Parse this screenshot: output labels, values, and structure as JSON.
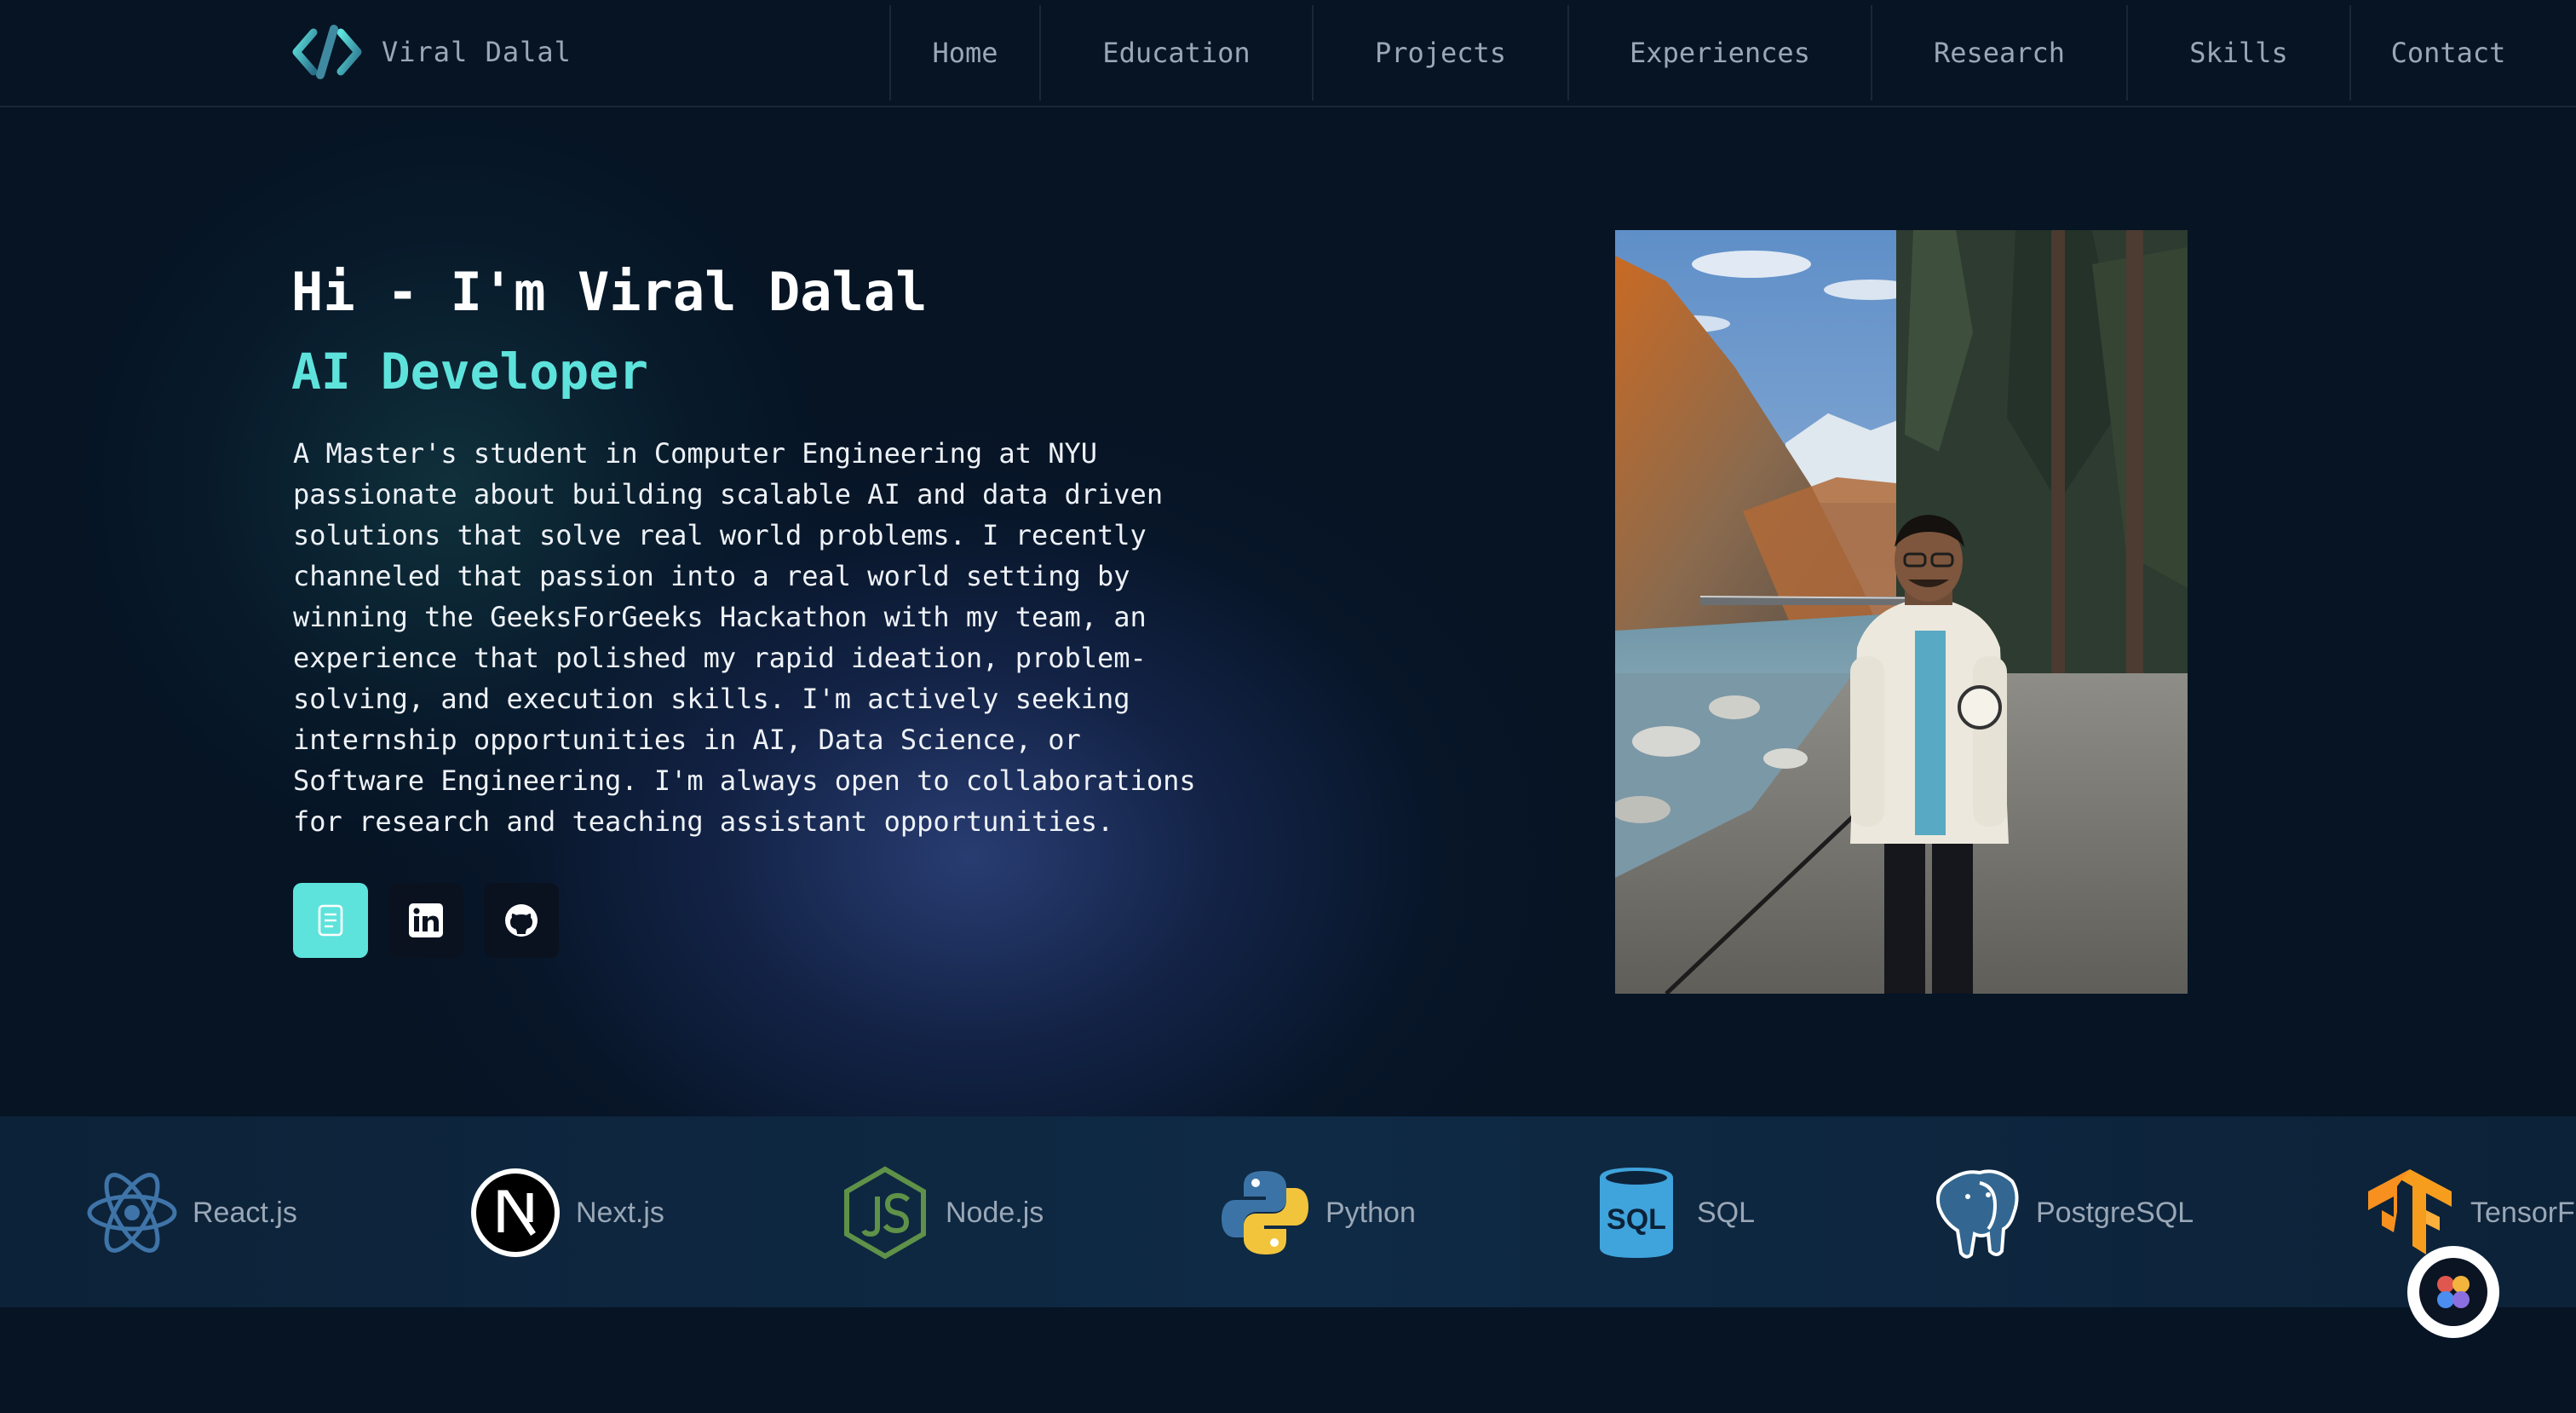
{
  "brand": {
    "name": "Viral Dalal",
    "logo_icon": "code-brackets-icon"
  },
  "nav": {
    "items": [
      {
        "label": "Home"
      },
      {
        "label": "Education"
      },
      {
        "label": "Projects"
      },
      {
        "label": "Experiences"
      },
      {
        "label": "Research"
      },
      {
        "label": "Skills"
      },
      {
        "label": "Contact"
      }
    ]
  },
  "hero": {
    "title": "Hi - I'm Viral Dalal",
    "role": "AI Developer",
    "bio_lines": [
      "A Master's student in Computer Engineering at NYU",
      "passionate about building scalable AI and data driven",
      "solutions that solve real world problems. I recently",
      "channeled that passion into a real world setting by",
      "winning the GeeksForGeeks Hackathon with my team, an",
      "experience that polished my rapid ideation, problem-",
      "solving, and execution skills. I'm actively seeking",
      "internship opportunities in AI, Data Science, or",
      "Software Engineering. I'm always open to collaborations",
      "for research and teaching assistant opportunities."
    ],
    "socials": [
      {
        "icon": "resume-icon"
      },
      {
        "icon": "linkedin-icon"
      },
      {
        "icon": "github-icon"
      }
    ],
    "accent_color": "#5ee3dc"
  },
  "tech": {
    "items": [
      {
        "label": "React.js",
        "icon": "react-icon"
      },
      {
        "label": "Next.js",
        "icon": "nextjs-icon"
      },
      {
        "label": "Node.js",
        "icon": "nodejs-icon"
      },
      {
        "label": "Python",
        "icon": "python-icon"
      },
      {
        "label": "SQL",
        "icon": "sql-icon"
      },
      {
        "label": "PostgreSQL",
        "icon": "postgresql-icon"
      },
      {
        "label": "TensorFlow",
        "icon": "tensorflow-icon"
      }
    ],
    "sql_icon_text": "SQL"
  },
  "colors": {
    "background": "#061424",
    "accent": "#5ee3dc",
    "nav_text": "#9aa7b6"
  }
}
